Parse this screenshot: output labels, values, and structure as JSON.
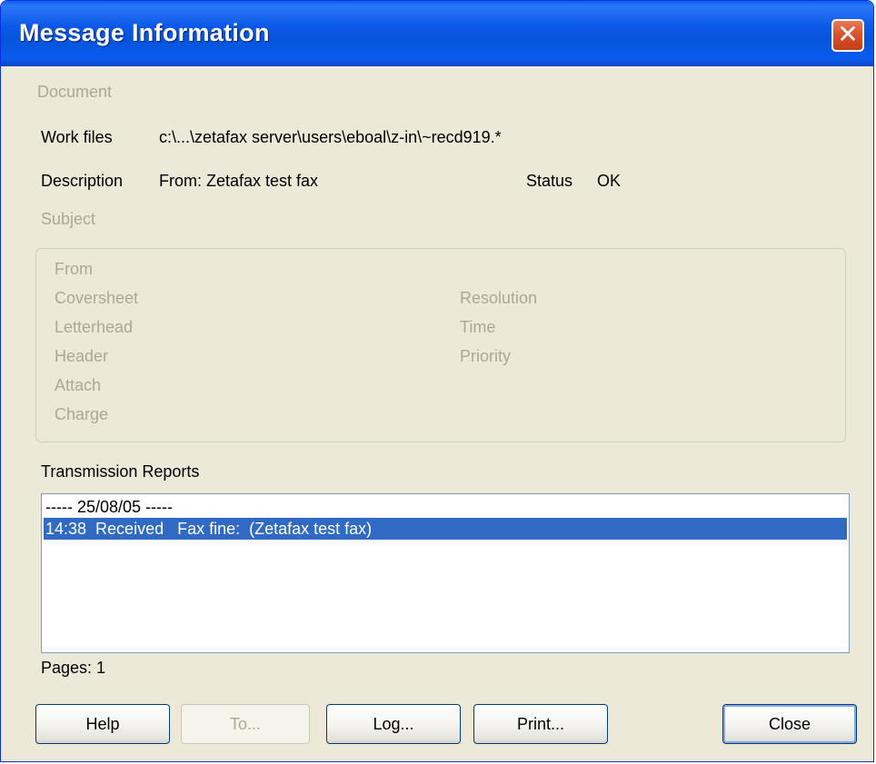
{
  "window": {
    "title": "Message Information"
  },
  "document": {
    "heading": "Document",
    "work_files_label": "Work files",
    "work_files_value": "c:\\...\\zetafax server\\users\\eboal\\z-in\\~recd919.*",
    "description_label": "Description",
    "description_value": "From: Zetafax test fax",
    "status_label": "Status",
    "status_value": "OK",
    "subject_label": "Subject"
  },
  "details": {
    "from_label": "From",
    "coversheet_label": "Coversheet",
    "letterhead_label": "Letterhead",
    "header_label": "Header",
    "attach_label": "Attach",
    "charge_label": "Charge",
    "resolution_label": "Resolution",
    "time_label": "Time",
    "priority_label": "Priority"
  },
  "reports": {
    "label": "Transmission Reports",
    "items": [
      "----- 25/08/05 -----",
      "14:38  Received   Fax fine:  (Zetafax test fax)"
    ],
    "selected_index": 1
  },
  "pages": {
    "text": "Pages: 1"
  },
  "buttons": {
    "help": "Help",
    "to": "To...",
    "log": "Log...",
    "print": "Print...",
    "close": "Close"
  },
  "colors": {
    "titlebar": "#0054e3",
    "selection": "#316ac5",
    "disabled_text": "#aca899",
    "dialog_bg": "#ece9d8"
  }
}
